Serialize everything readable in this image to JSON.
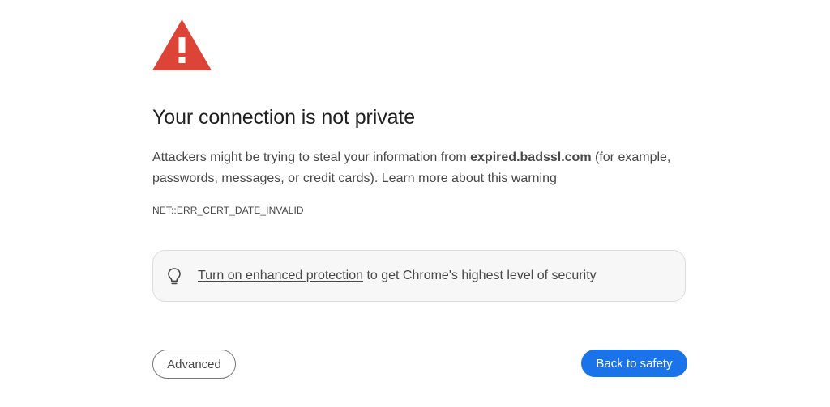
{
  "page": {
    "title": "Your connection is not private",
    "description_prefix": "Attackers might be trying to steal your information from ",
    "domain": "expired.badssl.com",
    "description_suffix": " (for example, passwords, messages, or credit cards). ",
    "learn_more_link": "Learn more about this warning",
    "error_code": "NET::ERR_CERT_DATE_INVALID"
  },
  "promo": {
    "link_text": "Turn on enhanced protection",
    "text": " to get Chrome's highest level of security",
    "icon": "lightbulb-icon"
  },
  "buttons": {
    "advanced_label": "Advanced",
    "back_label": "Back to safety"
  },
  "colors": {
    "warning_red": "#db4437",
    "primary_blue": "#1a73e8",
    "text_secondary": "#474747",
    "promo_background": "#f7f7f7"
  }
}
